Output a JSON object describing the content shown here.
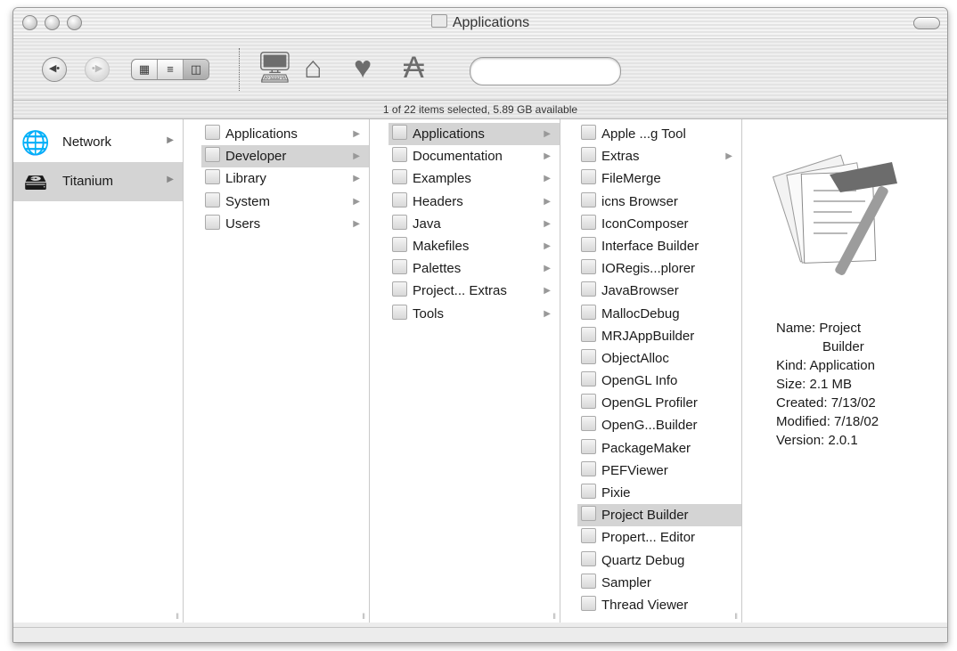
{
  "window": {
    "title": "Applications"
  },
  "toolbar": {
    "back_icon": "back-arrow-icon",
    "forward_icon": "forward-arrow-icon",
    "view_modes": [
      "icon",
      "list",
      "column"
    ],
    "shortcuts": [
      "computer-icon",
      "home-icon",
      "favorites-heart-icon",
      "applications-icon"
    ],
    "search_value": ""
  },
  "status": {
    "text": "1 of 22 items selected, 5.89 GB available"
  },
  "columns": {
    "volumes": [
      {
        "label": "Network",
        "icon": "network-globe-icon",
        "selected": false
      },
      {
        "label": "Titanium",
        "icon": "hard-drive-icon",
        "selected": true
      }
    ],
    "col2": [
      {
        "label": "Applications",
        "selected": false
      },
      {
        "label": "Developer",
        "selected": true
      },
      {
        "label": "Library",
        "selected": false
      },
      {
        "label": "System",
        "selected": false
      },
      {
        "label": "Users",
        "selected": false
      }
    ],
    "col3": [
      {
        "label": "Applications",
        "selected": true
      },
      {
        "label": "Documentation",
        "selected": false
      },
      {
        "label": "Examples",
        "selected": false
      },
      {
        "label": "Headers",
        "selected": false
      },
      {
        "label": "Java",
        "selected": false
      },
      {
        "label": "Makefiles",
        "selected": false
      },
      {
        "label": "Palettes",
        "selected": false
      },
      {
        "label": "Project... Extras",
        "selected": false
      },
      {
        "label": "Tools",
        "selected": false
      }
    ],
    "col4": [
      {
        "label": "Apple ...g Tool",
        "folder": false,
        "selected": false
      },
      {
        "label": "Extras",
        "folder": true,
        "selected": false
      },
      {
        "label": "FileMerge",
        "folder": false,
        "selected": false
      },
      {
        "label": "icns Browser",
        "folder": false,
        "selected": false
      },
      {
        "label": "IconComposer",
        "folder": false,
        "selected": false
      },
      {
        "label": "Interface Builder",
        "folder": false,
        "selected": false
      },
      {
        "label": "IORegis...plorer",
        "folder": false,
        "selected": false
      },
      {
        "label": "JavaBrowser",
        "folder": false,
        "selected": false
      },
      {
        "label": "MallocDebug",
        "folder": false,
        "selected": false
      },
      {
        "label": "MRJAppBuilder",
        "folder": false,
        "selected": false
      },
      {
        "label": "ObjectAlloc",
        "folder": false,
        "selected": false
      },
      {
        "label": "OpenGL Info",
        "folder": false,
        "selected": false
      },
      {
        "label": "OpenGL Profiler",
        "folder": false,
        "selected": false
      },
      {
        "label": "OpenG...Builder",
        "folder": false,
        "selected": false
      },
      {
        "label": "PackageMaker",
        "folder": false,
        "selected": false
      },
      {
        "label": "PEFViewer",
        "folder": false,
        "selected": false
      },
      {
        "label": "Pixie",
        "folder": false,
        "selected": false
      },
      {
        "label": "Project Builder",
        "folder": false,
        "selected": true
      },
      {
        "label": "Propert... Editor",
        "folder": false,
        "selected": false
      },
      {
        "label": "Quartz Debug",
        "folder": false,
        "selected": false
      },
      {
        "label": "Sampler",
        "folder": false,
        "selected": false
      },
      {
        "label": "Thread Viewer",
        "folder": false,
        "selected": false
      }
    ]
  },
  "preview": {
    "icon": "project-builder-hammer-icon",
    "name_label": "Name:",
    "name_value": "Project",
    "name_value2": "Builder",
    "kind_label": "Kind:",
    "kind_value": "Application",
    "size_label": "Size:",
    "size_value": "2.1 MB",
    "created_label": "Created:",
    "created_value": "7/13/02",
    "modified_label": "Modified:",
    "modified_value": "7/18/02",
    "version_label": "Version:",
    "version_value": "2.0.1"
  },
  "colors": {
    "selection": "#d4d4d4",
    "window_bg": "#ececec"
  }
}
